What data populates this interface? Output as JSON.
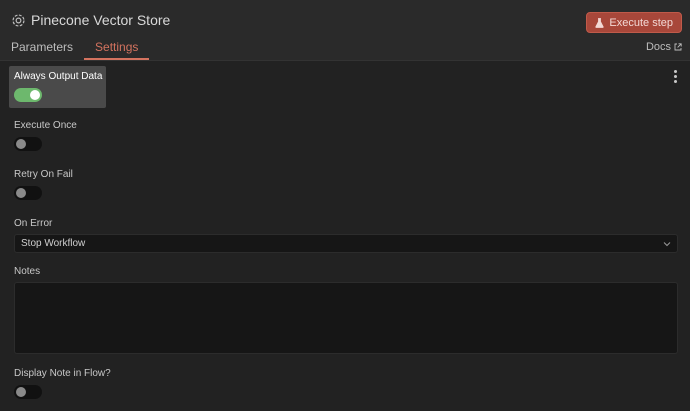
{
  "header": {
    "node_title": "Pinecone Vector Store",
    "node_icon": "gear-node-icon",
    "execute_label": "Execute step",
    "execute_icon": "flask-icon",
    "accent": "#a8473a"
  },
  "tabs": [
    {
      "label": "Parameters",
      "active": false
    },
    {
      "label": "Settings",
      "active": true
    }
  ],
  "docs": {
    "label": "Docs",
    "icon": "external-link-icon"
  },
  "settings": {
    "always_output": {
      "label": "Always Output Data",
      "value": true
    },
    "execute_once": {
      "label": "Execute Once",
      "value": false
    },
    "retry_on_fail": {
      "label": "Retry On Fail",
      "value": false
    },
    "on_error": {
      "label": "On Error",
      "value": "Stop Workflow"
    },
    "notes": {
      "label": "Notes",
      "value": ""
    },
    "display_note": {
      "label": "Display Note in Flow?",
      "value": false
    }
  },
  "colors": {
    "toggle_on": "#6db86d",
    "tab_active": "#d4735f"
  }
}
